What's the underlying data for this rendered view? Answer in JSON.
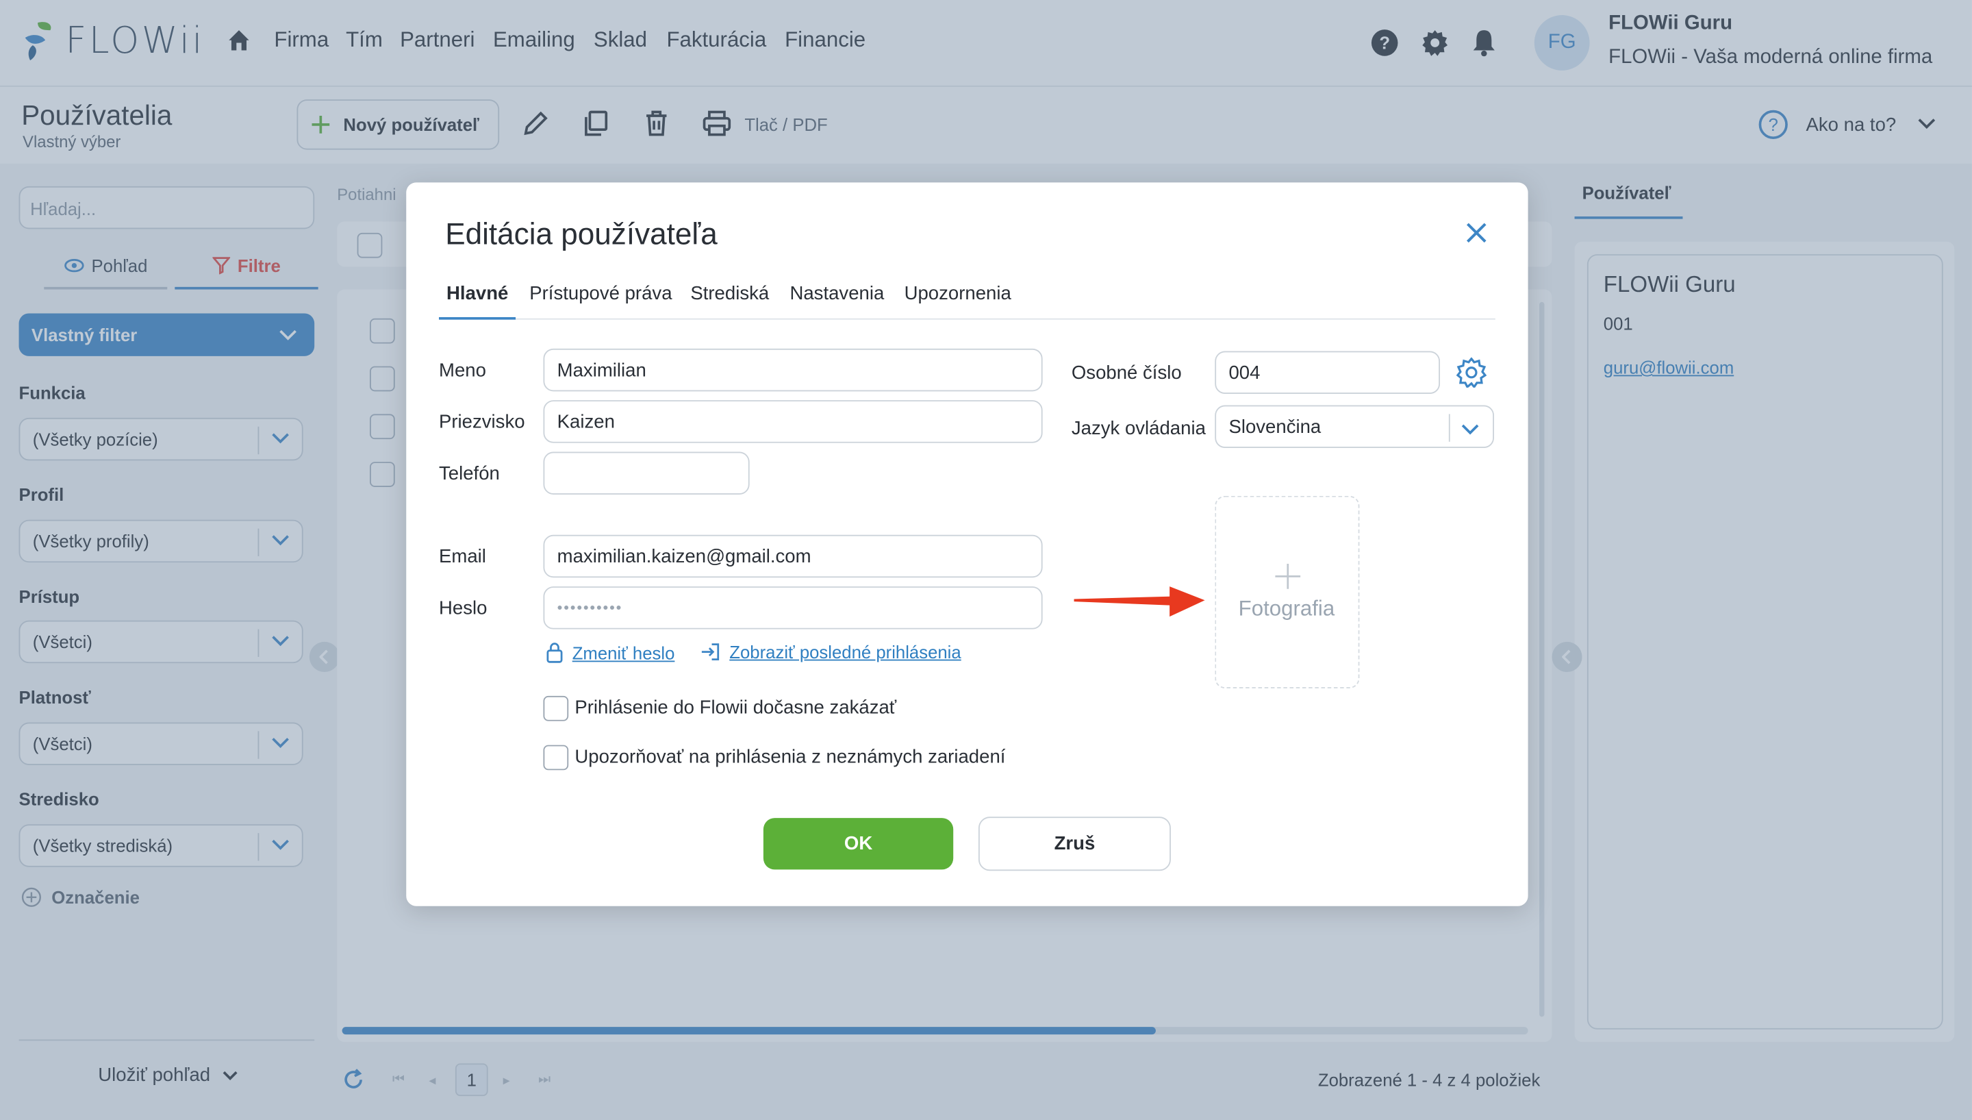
{
  "app": {
    "logo_text": "FLOWii"
  },
  "nav": {
    "items": [
      {
        "label": "Firma"
      },
      {
        "label": "Tím"
      },
      {
        "label": "Partneri"
      },
      {
        "label": "Emailing"
      },
      {
        "label": "Sklad"
      },
      {
        "label": "Fakturácia"
      },
      {
        "label": "Financie"
      }
    ]
  },
  "user": {
    "initials": "FG",
    "name": "FLOWii Guru",
    "company": "FLOWii - Vaša moderná online firma"
  },
  "page": {
    "title": "Používatelia",
    "subtitle": "Vlastný výber"
  },
  "toolbar": {
    "new_label": "Nový používateľ",
    "print_label": "Tlač / PDF",
    "help_label": "Ako na to?"
  },
  "left": {
    "search_placeholder": "Hľadaj...",
    "view_tab": "Pohľad",
    "filters_tab": "Filtre",
    "custom_filter": "Vlastný filter",
    "filters": [
      {
        "label": "Funkcia",
        "value": "(Všetky pozície)"
      },
      {
        "label": "Profil",
        "value": "(Všetky profily)"
      },
      {
        "label": "Prístup",
        "value": "(Všetci)"
      },
      {
        "label": "Platnosť",
        "value": "(Všetci)"
      },
      {
        "label": "Stredisko",
        "value": "(Všetky strediská)"
      }
    ],
    "tag_label": "Označenie",
    "save_view": "Uložiť pohľad"
  },
  "middle": {
    "drag_hint": "Potiahni",
    "page_number": "1",
    "footer_count": "Zobrazené 1 - 4 z 4 položiek"
  },
  "right": {
    "tab": "Používateľ",
    "name": "FLOWii Guru",
    "number": "001",
    "email": "guru@flowii.com"
  },
  "modal": {
    "title": "Editácia používateľa",
    "tabs": [
      {
        "label": "Hlavné"
      },
      {
        "label": "Prístupové práva"
      },
      {
        "label": "Strediská"
      },
      {
        "label": "Nastavenia"
      },
      {
        "label": "Upozornenia"
      }
    ],
    "fields": {
      "first_name": {
        "label": "Meno",
        "value": "Maximilian"
      },
      "last_name": {
        "label": "Priezvisko",
        "value": "Kaizen"
      },
      "phone": {
        "label": "Telefón",
        "value": ""
      },
      "email": {
        "label": "Email",
        "value": "maximilian.kaizen@gmail.com"
      },
      "password": {
        "label": "Heslo",
        "value": "••••••••••"
      },
      "personal_number": {
        "label": "Osobné číslo",
        "value": "004"
      },
      "language": {
        "label": "Jazyk ovládania",
        "value": "Slovenčina"
      }
    },
    "change_password": "Zmeniť heslo",
    "last_logins": "Zobraziť posledné prihlásenia",
    "photo_label": "Fotografia",
    "checkbox_disable": "Prihlásenie do Flowii dočasne zakázať",
    "checkbox_notify": "Upozorňovať na prihlásenia z neznámych zariadení",
    "ok": "OK",
    "cancel": "Zruš"
  },
  "colors": {
    "accent": "#3d86c6",
    "ok_green": "#5cb038",
    "arrow_red": "#e8391f",
    "filter_red": "#e0453f"
  }
}
